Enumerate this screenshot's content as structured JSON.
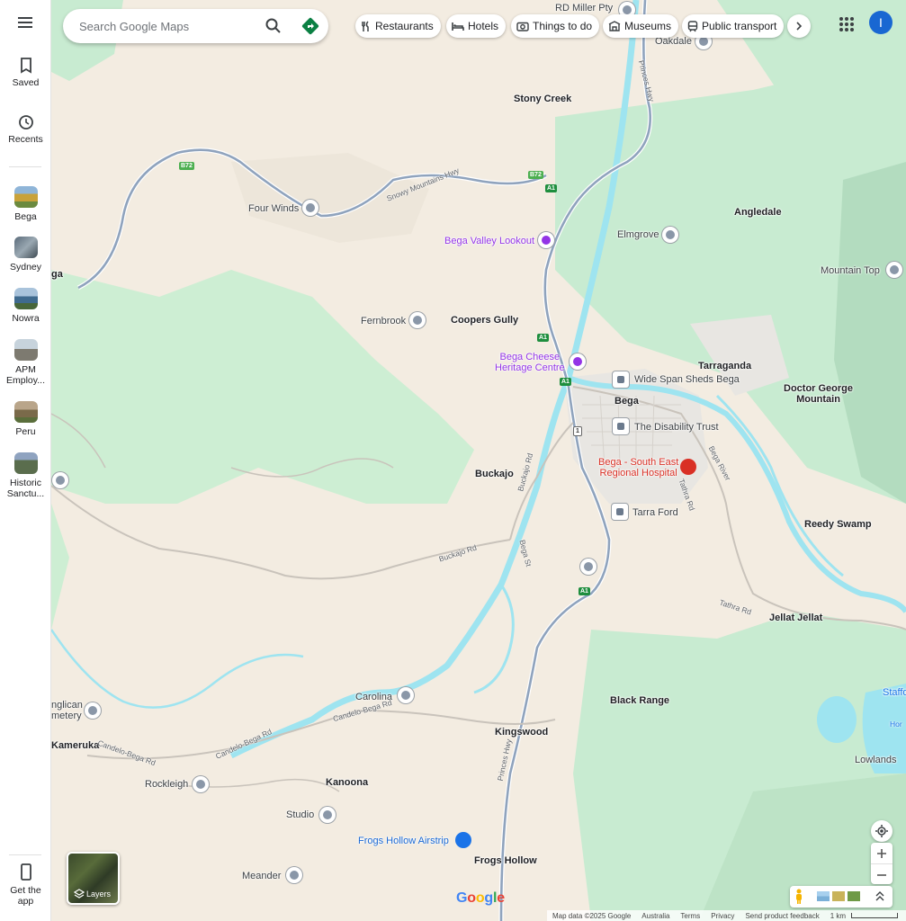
{
  "rail": {
    "menu_icon": "menu-icon",
    "saved_label": "Saved",
    "recents_label": "Recents",
    "history": [
      {
        "label": "Bega"
      },
      {
        "label": "Sydney"
      },
      {
        "label": "Nowra"
      },
      {
        "label": "APM Employ..."
      },
      {
        "label": "Peru"
      },
      {
        "label": "Historic Sanctu..."
      }
    ],
    "get_app_label": "Get the app"
  },
  "search": {
    "placeholder": "Search Google Maps"
  },
  "chips": [
    {
      "label": "Restaurants",
      "icon": "restaurant-icon"
    },
    {
      "label": "Hotels",
      "icon": "hotel-icon"
    },
    {
      "label": "Things to do",
      "icon": "camera-icon"
    },
    {
      "label": "Museums",
      "icon": "museum-icon"
    },
    {
      "label": "Public transport",
      "icon": "transit-icon"
    }
  ],
  "account": {
    "initial": "I"
  },
  "map": {
    "places": {
      "rd_miller_pty": "RD Miller Pty",
      "oakdale": "Oakdale",
      "stony_creek": "Stony Creek",
      "four_winds": "Four Winds",
      "angledale": "Angledale",
      "bega_valley_lookout": "Bega Valley Lookout",
      "elmgrove": "Elmgrove",
      "mountain_top": "Mountain Top",
      "ega": "ga",
      "fernbrook": "Fernbrook",
      "coopers_gully": "Coopers Gully",
      "bega_cheese_1": "Bega Cheese",
      "bega_cheese_2": "Heritage Centre",
      "tarraganda": "Tarraganda",
      "wide_span": "Wide Span Sheds Bega",
      "doctor_george_1": "Doctor George",
      "doctor_george_2": "Mountain",
      "bega": "Bega",
      "disability_trust": "The Disability Trust",
      "hospital_1": "Bega - South East",
      "hospital_2": "Regional Hospital",
      "buckajo": "Buckajo",
      "tarra_ford": "Tarra Ford",
      "reedy_swamp": "Reedy Swamp",
      "jellat_jellat": "Jellat Jellat",
      "black_range": "Black Range",
      "staff": "Staffo",
      "carolina": "Carolina",
      "anglican_1": "nglican",
      "anglican_2": "metery",
      "kameruka": "Kameruka",
      "kingswood": "Kingswood",
      "lowlands": "Lowlands",
      "rockleigh": "Rockleigh",
      "kanoona": "Kanoona",
      "studio": "Studio",
      "frogs_hollow_airstrip": "Frogs Hollow Airstrip",
      "meander": "Meander",
      "frogs_hollow": "Frogs Hollow"
    },
    "roads": {
      "princes_hwy": "Princes Hwy",
      "snowy_mountains_hwy": "Snowy Mountains Hwy",
      "b72": "B72",
      "a1": "A1",
      "one": "1",
      "buckajo_rd": "Buckajo Rd",
      "bega_st": "Bega St",
      "tathra_rd": "Tathra Rd",
      "bega_river": "Bega River",
      "candelo_bega_rd": "Candelo-Bega Rd",
      "hor": "Hor"
    }
  },
  "layers_label": "Layers",
  "logo": "Google",
  "footer": {
    "map_data": "Map data ©2025 Google",
    "country": "Australia",
    "terms": "Terms",
    "privacy": "Privacy",
    "feedback": "Send product feedback",
    "scale": "1 km"
  },
  "colors": {
    "land": "#f3ece1",
    "forest": "#c8ebd1",
    "water": "#9ee4f0",
    "road": "#8fa3bd",
    "accent": "#1a73e8"
  }
}
